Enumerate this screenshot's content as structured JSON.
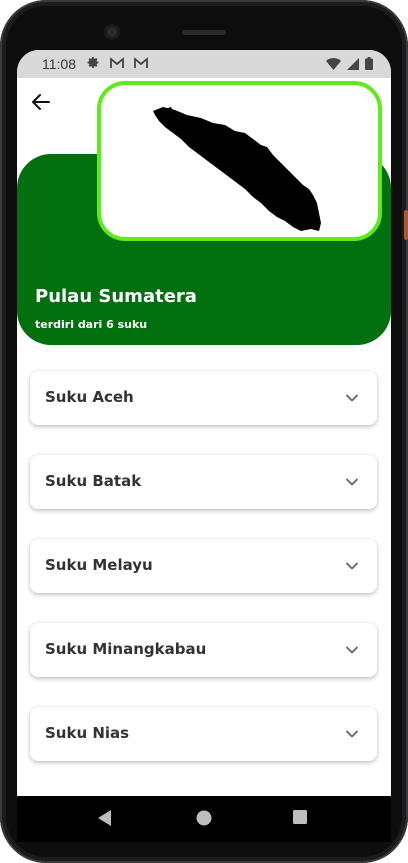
{
  "status_bar": {
    "time": "11:08"
  },
  "header": {
    "back_icon": "arrow-left-icon",
    "island_name": "Pulau Sumatera",
    "subtitle": "terdiri dari 6 suku",
    "map_image": "sumatra-island-silhouette"
  },
  "colors": {
    "hero_green": "#02700f",
    "map_border": "#5ceb1d"
  },
  "tribes": [
    {
      "label": "Suku Aceh"
    },
    {
      "label": "Suku Batak"
    },
    {
      "label": "Suku Melayu"
    },
    {
      "label": "Suku Minangkabau"
    },
    {
      "label": "Suku Nias"
    }
  ]
}
